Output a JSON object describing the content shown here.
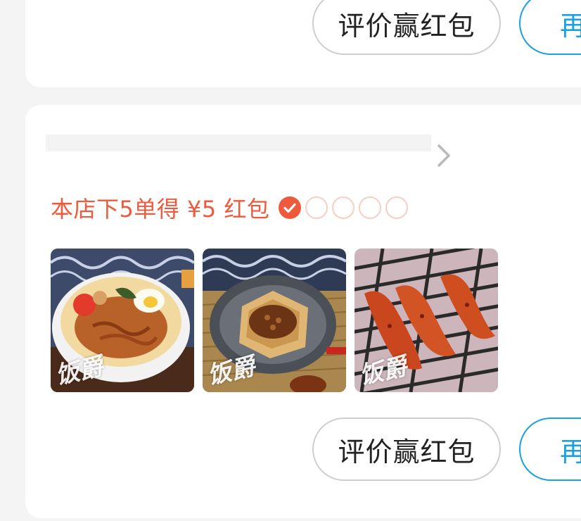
{
  "top_card": {
    "review_label": "评价赢红包",
    "reorder_label": "再来一单"
  },
  "order_card": {
    "store_name": "",
    "promo": {
      "text": "本店下5单得 ¥5 红包",
      "orders_completed": 1,
      "orders_required": 5
    },
    "photos": [
      {
        "icon": "noodle-bowl-photo",
        "watermark": "饭爵"
      },
      {
        "icon": "tofu-pouch-photo",
        "watermark": "饭爵"
      },
      {
        "icon": "chicken-wings-photo",
        "watermark": "饭爵"
      }
    ],
    "review_label": "评价赢红包",
    "reorder_label": "再来一单"
  },
  "colors": {
    "promo_red": "#ef5a3c",
    "reorder_blue": "#1aa1e0"
  }
}
